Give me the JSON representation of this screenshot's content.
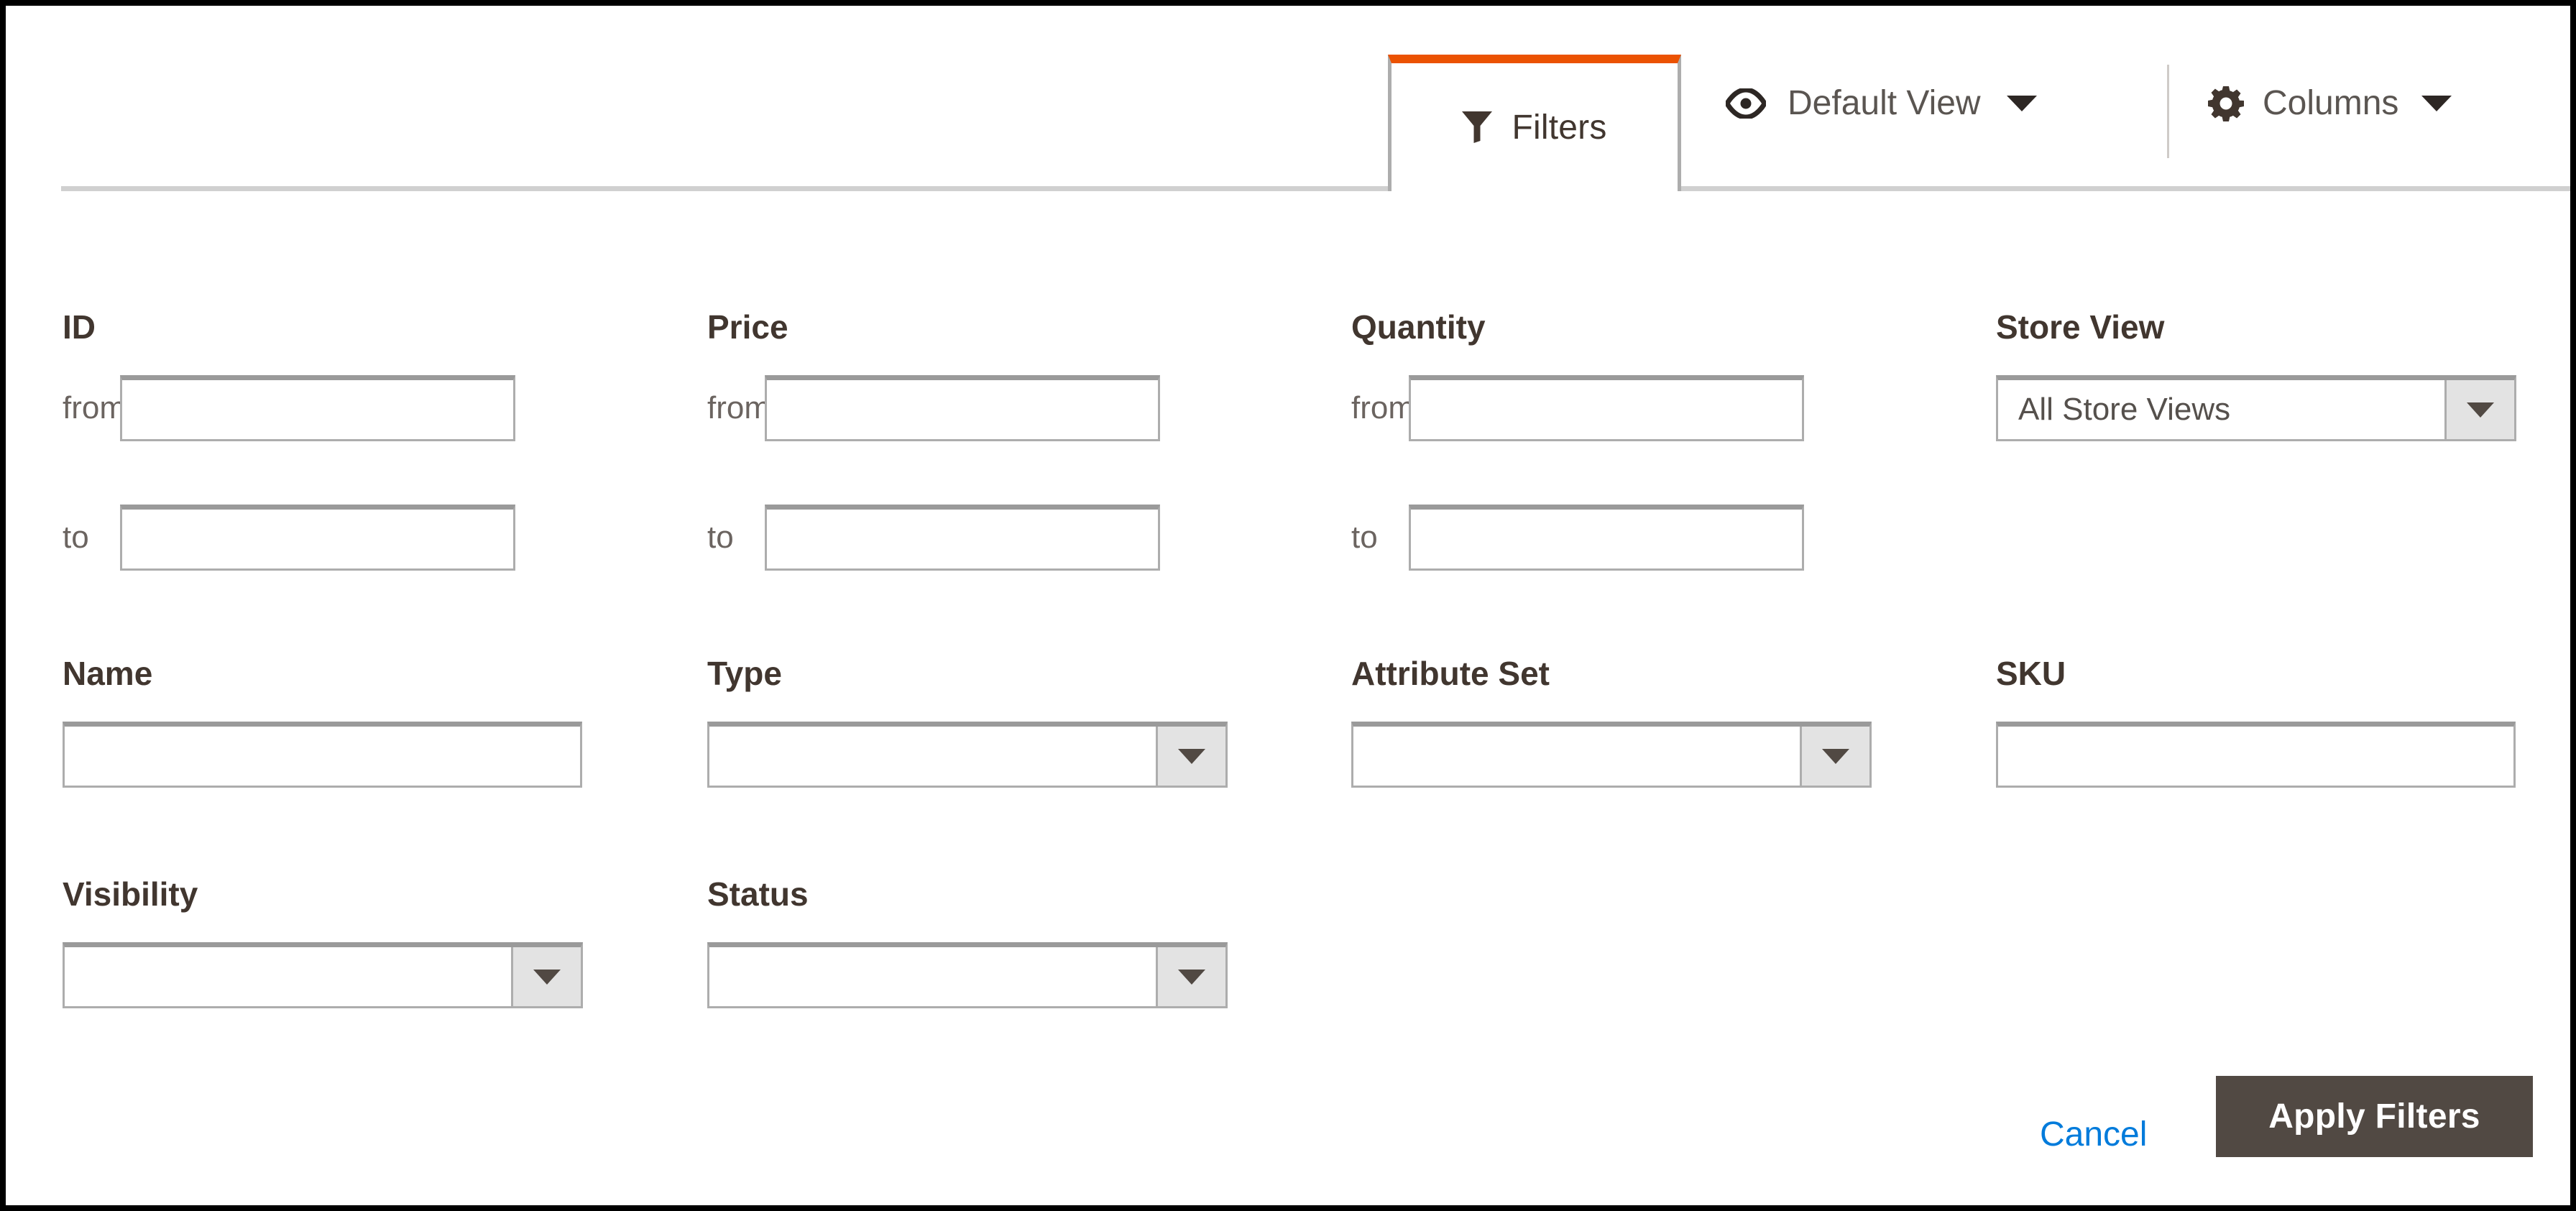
{
  "toolbar": {
    "filters_tab": {
      "label": "Filters",
      "icon": "funnel-icon",
      "active": true,
      "accent_color": "#eb5202"
    },
    "default_view": {
      "label": "Default View",
      "icon": "eye-icon",
      "caret": "chevron-down-icon"
    },
    "columns": {
      "label": "Columns",
      "icon": "gear-icon",
      "caret": "chevron-down-icon"
    }
  },
  "filters": {
    "id": {
      "label": "ID",
      "from_label": "from",
      "to_label": "to",
      "from_value": "",
      "to_value": ""
    },
    "price": {
      "label": "Price",
      "from_label": "from",
      "to_label": "to",
      "from_value": "",
      "to_value": ""
    },
    "quantity": {
      "label": "Quantity",
      "from_label": "from",
      "to_label": "to",
      "from_value": "",
      "to_value": ""
    },
    "store_view": {
      "label": "Store View",
      "selected": "All Store Views"
    },
    "name": {
      "label": "Name",
      "value": ""
    },
    "type": {
      "label": "Type",
      "selected": ""
    },
    "attribute_set": {
      "label": "Attribute Set",
      "selected": ""
    },
    "sku": {
      "label": "SKU",
      "value": ""
    },
    "visibility": {
      "label": "Visibility",
      "selected": ""
    },
    "status": {
      "label": "Status",
      "selected": ""
    }
  },
  "actions": {
    "cancel_label": "Cancel",
    "apply_label": "Apply Filters",
    "cancel_color": "#007bdb",
    "apply_bg": "#514943"
  }
}
